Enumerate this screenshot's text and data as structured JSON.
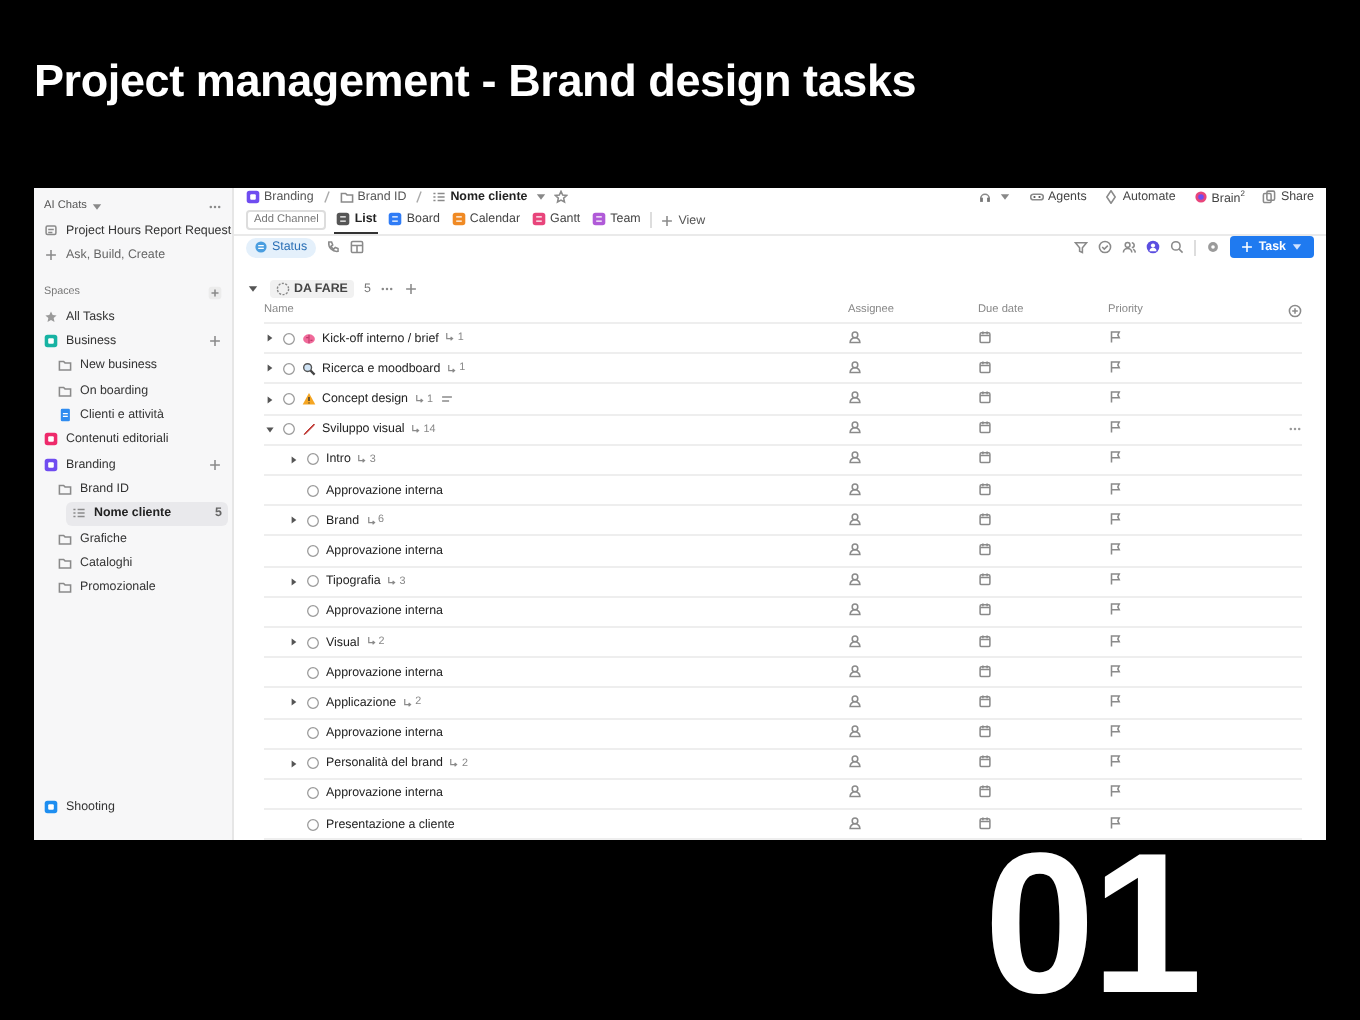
{
  "title": "Project management - Brand design tasks",
  "corner_number": "01",
  "sidebar": {
    "header": "AI Chats",
    "shortcuts": [
      {
        "label": "Project Hours Report Request",
        "kind": "chat"
      },
      {
        "label": "Ask, Build, Create",
        "kind": "add"
      }
    ],
    "spaces_label": "Spaces",
    "tree": [
      {
        "label": "All Tasks",
        "kind": "all",
        "selected": false
      },
      {
        "label": "Business",
        "kind": "space",
        "color": "#17b3a3",
        "selected": false,
        "children": [
          {
            "label": "New business",
            "kind": "folder",
            "selected": false
          },
          {
            "label": "On boarding",
            "kind": "folder",
            "selected": false
          },
          {
            "label": "Clienti e attività",
            "kind": "doc",
            "selected": false
          }
        ]
      },
      {
        "label": "Contenuti editoriali",
        "kind": "space",
        "color": "#ee2a6b",
        "selected": false
      },
      {
        "label": "Branding",
        "kind": "space",
        "color": "#6f4cf0",
        "selected": false,
        "children": [
          {
            "label": "Brand ID",
            "kind": "folder",
            "selected": false,
            "children": [
              {
                "label": "Nome cliente",
                "kind": "list",
                "count": "5",
                "selected": true
              }
            ]
          },
          {
            "label": "Grafiche",
            "kind": "folder",
            "selected": false
          },
          {
            "label": "Cataloghi",
            "kind": "folder",
            "selected": false
          },
          {
            "label": "Promozionale",
            "kind": "folder",
            "selected": false
          }
        ]
      },
      {
        "label": "Shooting",
        "kind": "space",
        "color": "#1e8ef0",
        "selected": false
      }
    ]
  },
  "breadcrumb": [
    {
      "label": "Branding",
      "kind": "space",
      "color": "#6f4cf0"
    },
    {
      "label": "Brand ID",
      "kind": "folder"
    },
    {
      "label": "Nome cliente",
      "kind": "list"
    }
  ],
  "actions": [
    {
      "label": "Agents",
      "kind": "agents"
    },
    {
      "label": "Automate",
      "kind": "automate"
    },
    {
      "label": "Brain$^{2}$",
      "kind": "brain"
    },
    {
      "label": "Share",
      "kind": "share"
    }
  ],
  "views": {
    "add_channel": "Add Channel",
    "add_view": "View",
    "tabs": [
      {
        "label": "List",
        "selected": true,
        "color": "#555555"
      },
      {
        "label": "Board",
        "selected": false,
        "color": "#2f7cf6"
      },
      {
        "label": "Calendar",
        "selected": false,
        "color": "#f08a24"
      },
      {
        "label": "Gantt",
        "selected": false,
        "color": "#e8457b"
      },
      {
        "label": "Team",
        "selected": false,
        "color": "#b05ad8"
      }
    ]
  },
  "toolbar": {
    "status_chip": "Status",
    "new_task": "Task"
  },
  "group": {
    "label": "DA FARE",
    "count": "5",
    "expanded": true
  },
  "table": {
    "columns": [
      "Name",
      "Assignee",
      "Due date",
      "Priority"
    ],
    "rows": [
      {
        "name": "Kick-off interno / brief",
        "kind": "brain",
        "subtasks": "1",
        "expanded": false,
        "hovered": false
      },
      {
        "name": "Ricerca e moodboard",
        "kind": "search",
        "subtasks": "1",
        "expanded": false,
        "hovered": false
      },
      {
        "name": "Concept design",
        "kind": "warning",
        "subtasks": "1",
        "expanded": false,
        "has_description": true,
        "hovered": false
      },
      {
        "name": "Sviluppo visual",
        "kind": "pencil",
        "subtasks": "14",
        "expanded": true,
        "hovered": true,
        "children": [
          {
            "name": "Intro",
            "subtasks": "3",
            "expanded": false,
            "hovered": false
          },
          {
            "name": "Approvazione interna",
            "hovered": false
          },
          {
            "name": "Brand",
            "subtasks": "6",
            "expanded": false,
            "hovered": false
          },
          {
            "name": "Approvazione interna",
            "hovered": false
          },
          {
            "name": "Tipografia",
            "subtasks": "3",
            "expanded": false,
            "hovered": false
          },
          {
            "name": "Approvazione interna",
            "hovered": false
          },
          {
            "name": "Visual",
            "subtasks": "2",
            "expanded": false,
            "hovered": false
          },
          {
            "name": "Approvazione interna",
            "hovered": false
          },
          {
            "name": "Applicazione",
            "subtasks": "2",
            "expanded": false,
            "hovered": false
          },
          {
            "name": "Approvazione interna",
            "hovered": false
          },
          {
            "name": "Personalità del brand",
            "subtasks": "2",
            "expanded": false,
            "hovered": false
          },
          {
            "name": "Approvazione interna",
            "hovered": false
          },
          {
            "name": "Presentazione a cliente",
            "hovered": false
          }
        ]
      }
    ]
  }
}
